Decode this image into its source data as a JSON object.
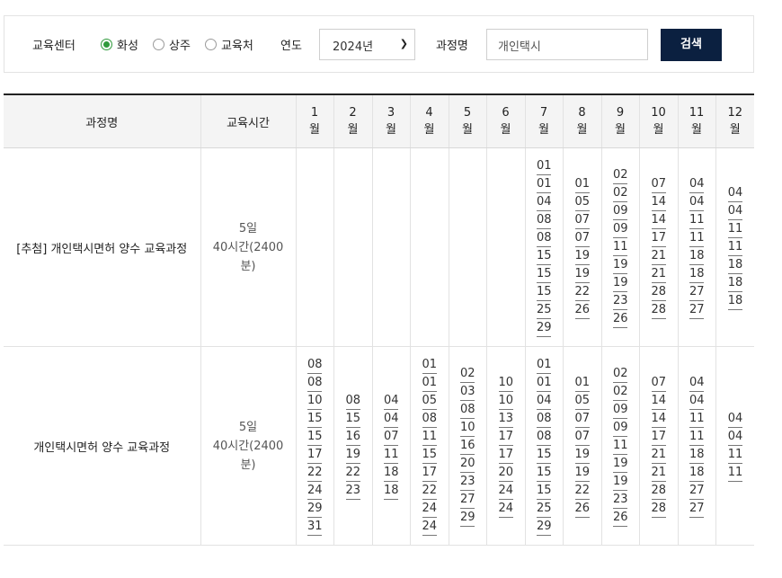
{
  "search": {
    "center_label": "교육센터",
    "centers": [
      {
        "label": "화성",
        "checked": true
      },
      {
        "label": "상주",
        "checked": false
      },
      {
        "label": "교육처",
        "checked": false
      }
    ],
    "year_label": "연도",
    "year_value": "2024년",
    "course_label": "과정명",
    "course_value": "개인택시",
    "search_button": "검색"
  },
  "table": {
    "headers": {
      "course": "과정명",
      "hours": "교육시간",
      "months": [
        [
          "1",
          "월"
        ],
        [
          "2",
          "월"
        ],
        [
          "3",
          "월"
        ],
        [
          "4",
          "월"
        ],
        [
          "5",
          "월"
        ],
        [
          "6",
          "월"
        ],
        [
          "7",
          "월"
        ],
        [
          "8",
          "월"
        ],
        [
          "9",
          "월"
        ],
        [
          "10",
          "월"
        ],
        [
          "11",
          "월"
        ],
        [
          "12",
          "월"
        ]
      ]
    },
    "rows": [
      {
        "course": "[추첨] 개인택시면허 양수 교육과정",
        "hours": [
          "5일",
          "40시간(2400",
          "분)"
        ],
        "months": [
          [],
          [],
          [],
          [],
          [],
          [],
          [
            "01",
            "01",
            "04",
            "08",
            "08",
            "15",
            "15",
            "15",
            "25",
            "29"
          ],
          [
            "01",
            "05",
            "07",
            "07",
            "19",
            "19",
            "22",
            "26"
          ],
          [
            "02",
            "02",
            "09",
            "09",
            "11",
            "19",
            "19",
            "23",
            "26"
          ],
          [
            "07",
            "14",
            "14",
            "17",
            "21",
            "21",
            "28",
            "28"
          ],
          [
            "04",
            "04",
            "11",
            "11",
            "18",
            "18",
            "27",
            "27"
          ],
          [
            "04",
            "04",
            "11",
            "11",
            "18",
            "18",
            "18"
          ]
        ]
      },
      {
        "course": "개인택시면허 양수 교육과정",
        "hours": [
          "5일",
          "40시간(2400",
          "분)"
        ],
        "months": [
          [
            "08",
            "08",
            "10",
            "15",
            "15",
            "17",
            "22",
            "24",
            "29",
            "31"
          ],
          [
            "08",
            "15",
            "16",
            "19",
            "22",
            "23"
          ],
          [
            "04",
            "04",
            "07",
            "11",
            "18",
            "18"
          ],
          [
            "01",
            "01",
            "05",
            "08",
            "11",
            "15",
            "17",
            "22",
            "24",
            "24"
          ],
          [
            "02",
            "03",
            "08",
            "10",
            "16",
            "20",
            "23",
            "27",
            "29"
          ],
          [
            "10",
            "10",
            "13",
            "17",
            "17",
            "20",
            "24",
            "24"
          ],
          [
            "01",
            "01",
            "04",
            "08",
            "08",
            "15",
            "15",
            "15",
            "25",
            "29"
          ],
          [
            "01",
            "05",
            "07",
            "07",
            "19",
            "19",
            "22",
            "26"
          ],
          [
            "02",
            "02",
            "09",
            "09",
            "11",
            "19",
            "19",
            "23",
            "26"
          ],
          [
            "07",
            "14",
            "14",
            "17",
            "21",
            "21",
            "28",
            "28"
          ],
          [
            "04",
            "04",
            "11",
            "11",
            "18",
            "18",
            "27",
            "27"
          ],
          [
            "04",
            "04",
            "11",
            "11"
          ]
        ]
      }
    ]
  }
}
